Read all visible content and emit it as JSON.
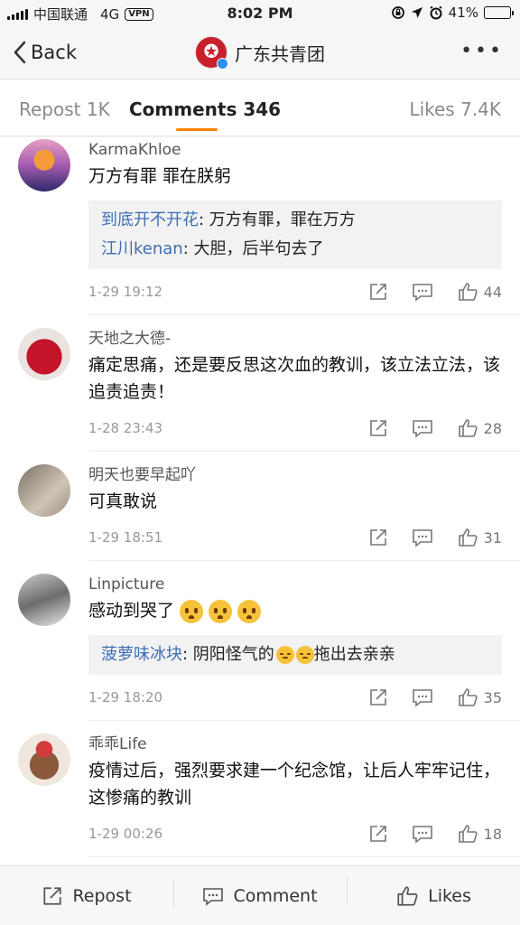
{
  "status_bar": {
    "carrier": "中国联通",
    "network": "4G",
    "vpn": "VPN",
    "time": "8:02 PM",
    "battery": "41%",
    "battery_level": 0.41
  },
  "nav": {
    "back_label": "Back",
    "title": "广东共青团",
    "more": "•••"
  },
  "tabs": {
    "repost": "Repost 1K",
    "comments": "Comments 346",
    "likes": "Likes 7.4K"
  },
  "comments": [
    {
      "user": "KarmaKhloe",
      "text": "万方有罪 罪在朕躬",
      "replies": [
        {
          "who": "到底开不开花",
          "text": ": 万方有罪，罪在万方"
        },
        {
          "who": "江川kenan",
          "text": ": 大胆，后半句去了"
        }
      ],
      "date": "1-29 19:12",
      "likes": "44"
    },
    {
      "user": "天地之大德-",
      "text": "痛定思痛，还是要反思这次血的教训，该立法立法，该追责追责！",
      "date": "1-28 23:43",
      "likes": "28"
    },
    {
      "user": "明天也要早起吖",
      "text": "可真敢说",
      "date": "1-29 18:51",
      "likes": "31"
    },
    {
      "user": "Linpicture",
      "text": "感动到哭了",
      "replies": [
        {
          "who": "菠萝味冰块",
          "text": ": 阴阳怪气的",
          "text2": "拖出去亲亲"
        }
      ],
      "date": "1-29 18:20",
      "likes": "35"
    },
    {
      "user": "乖乖Life",
      "text": "疫情过后，强烈要求建一个纪念馆，让后人牢牢记住，这惨痛的教训",
      "date": "1-29 00:26",
      "likes": "18"
    }
  ],
  "bottom_bar": {
    "repost": "Repost",
    "comment": "Comment",
    "likes": "Likes"
  }
}
